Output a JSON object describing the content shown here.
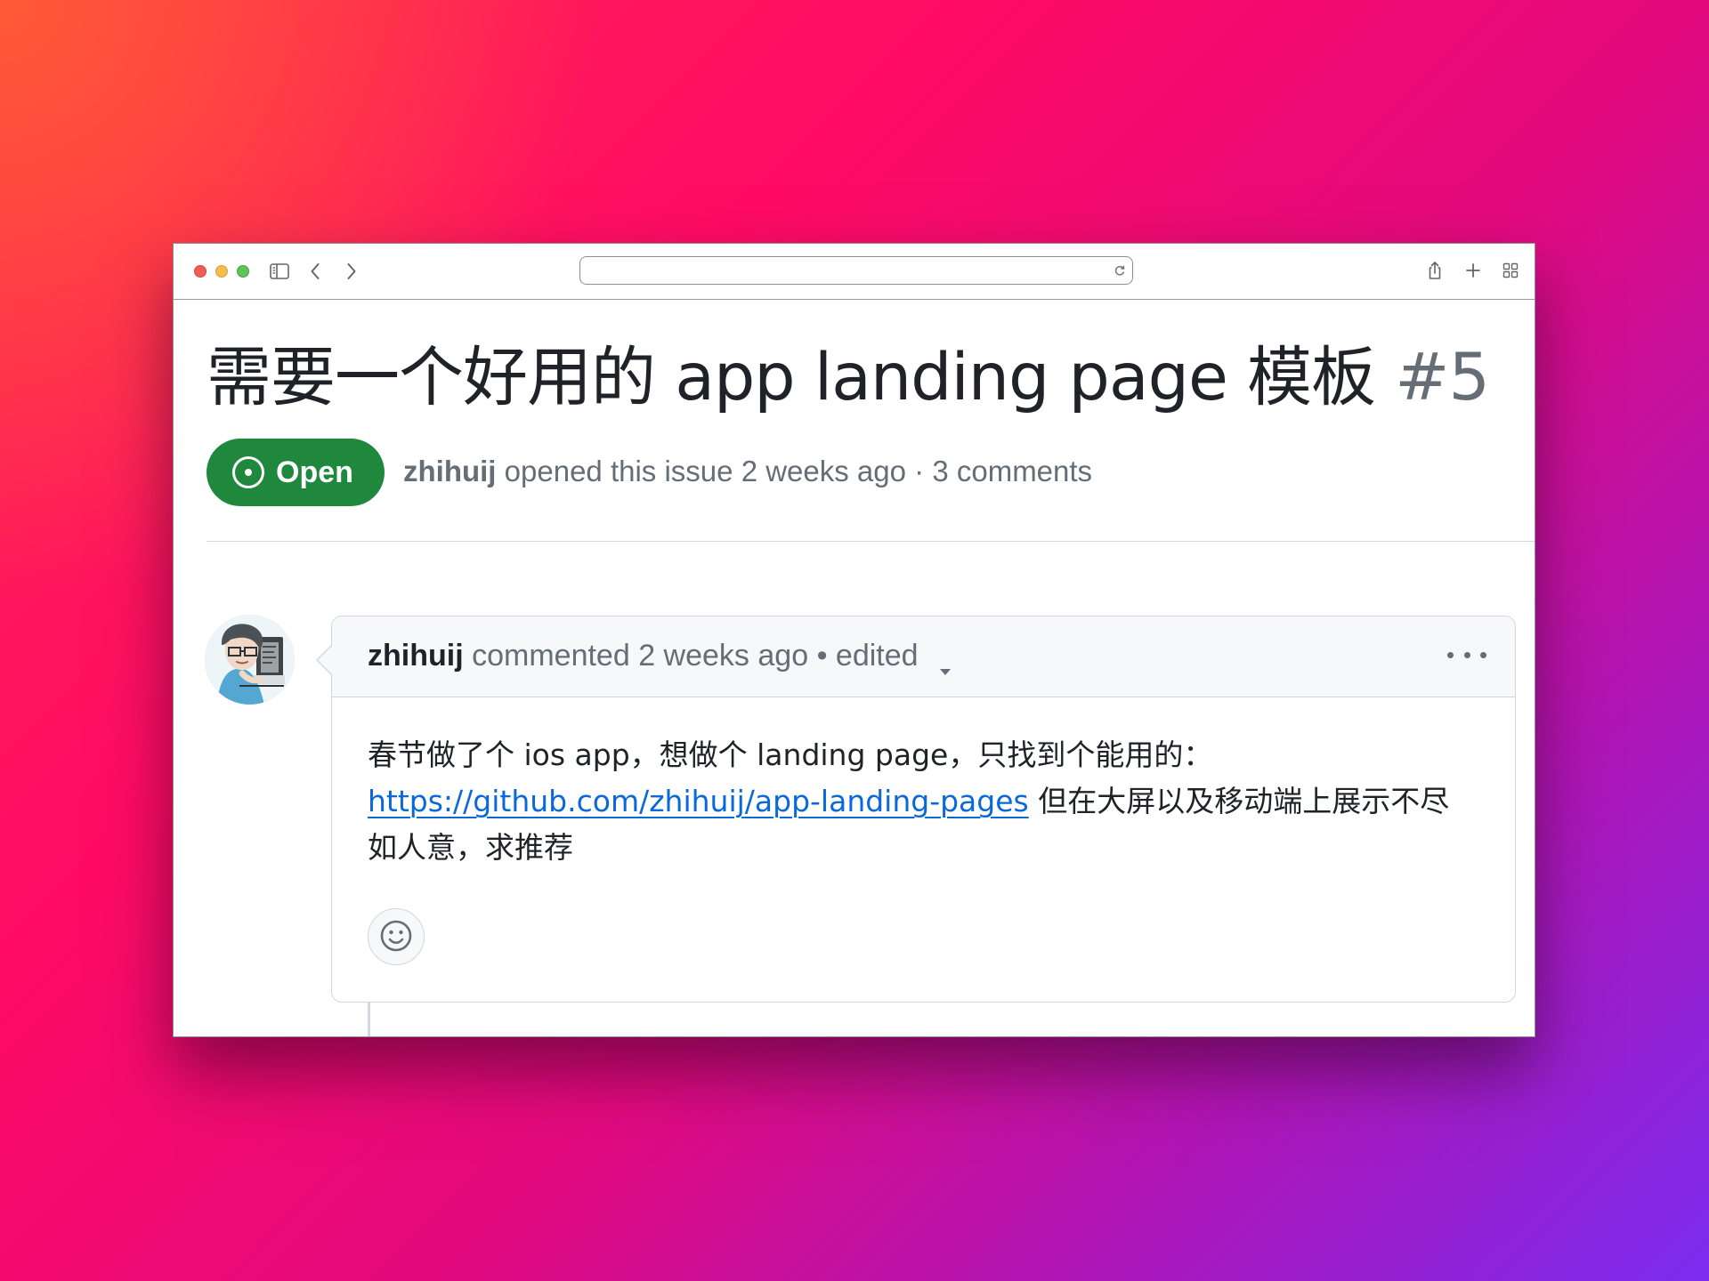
{
  "browser": {
    "address_value": "",
    "icons": [
      "sidebar-icon",
      "back-icon",
      "forward-icon",
      "reload-icon",
      "share-icon",
      "new-tab-icon",
      "tab-overview-icon"
    ]
  },
  "issue": {
    "title": "需要一个好用的 app landing page 模板",
    "number": "#5",
    "state": "Open",
    "author": "zhihuij",
    "opened_text": "opened this issue",
    "opened_time": "2 weeks ago",
    "separator": "·",
    "comment_count": "3 comments"
  },
  "comment": {
    "author": "zhihuij",
    "action": "commented",
    "time": "2 weeks ago",
    "separator": "•",
    "edited": "edited",
    "body": {
      "line1": "春节做了个 ios app，想做个 landing page，只找到个能用的：",
      "link": "https://github.com/zhihuij/app-landing-pages",
      "line2_after_link": " 但在大屏以及移动端上展示不尽",
      "line3": "如人意，求推荐"
    },
    "icons": [
      "avatar",
      "dropdown-caret-icon",
      "more-icon",
      "smiley-icon"
    ]
  },
  "colors": {
    "open_green": "#1f883d",
    "link_blue": "#0969da",
    "muted_text": "#656d76",
    "border": "#d0d7de",
    "header_bg": "#f6f8fa"
  }
}
